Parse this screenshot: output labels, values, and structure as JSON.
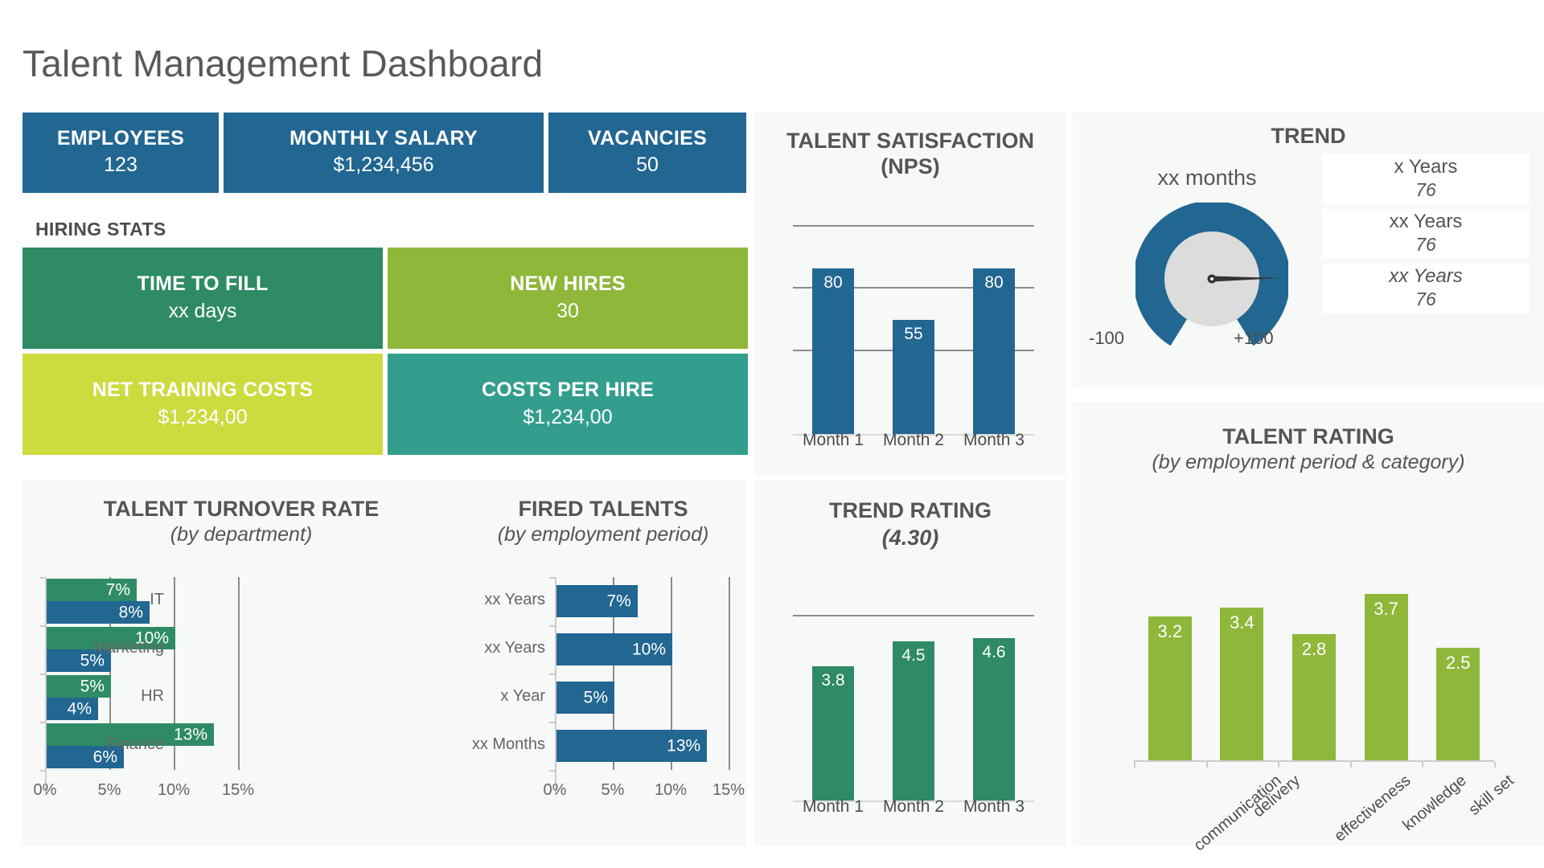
{
  "title": "Talent Management Dashboard",
  "colors": {
    "blue": "#226692",
    "dark_green": "#2e8b66",
    "green": "#8fb73a",
    "yellow_green": "#ccdb3e",
    "teal": "#339e8d",
    "panel_bg": "#f7f8f8",
    "text": "#555555"
  },
  "kpis": [
    {
      "label": "EMPLOYEES",
      "value": "123"
    },
    {
      "label": "MONTHLY SALARY",
      "value": "$1,234,456"
    },
    {
      "label": "VACANCIES",
      "value": "50"
    }
  ],
  "hiring": {
    "section_label": "HIRING STATS",
    "tiles": [
      {
        "label": "TIME TO FILL",
        "value": "xx days"
      },
      {
        "label": "NEW HIRES",
        "value": "30"
      },
      {
        "label": "NET TRAINING COSTS",
        "value": "$1,234,00"
      },
      {
        "label": "COSTS PER HIRE",
        "value": "$1,234,00"
      }
    ]
  },
  "trend": {
    "title": "TREND",
    "months_label": "xx months",
    "gauge_min_label": "-100",
    "gauge_max_label": "+100",
    "cards": [
      {
        "label": "x Years",
        "value": "76"
      },
      {
        "label": "xx Years",
        "value": "76"
      },
      {
        "label": "xx Years",
        "value": "76"
      }
    ]
  },
  "chart_data": [
    {
      "type": "bar",
      "id": "nps",
      "title": "TALENT SATISFACTION",
      "subtitle": "(NPS)",
      "categories": [
        "Month 1",
        "Month 2",
        "Month 3"
      ],
      "values": [
        80,
        55,
        80
      ],
      "value_labels": [
        "80",
        "55",
        "80"
      ],
      "series": [
        {
          "name": "NPS",
          "values": [
            80,
            55,
            80
          ]
        }
      ],
      "ylim": [
        0,
        100
      ],
      "gridlines": [
        40,
        70,
        100
      ],
      "grid": true,
      "legend": "none",
      "xlabel": "",
      "ylabel": "",
      "color": "#226692"
    },
    {
      "type": "bar",
      "id": "trend-rating",
      "title": "TREND RATING",
      "subtitle": "(4.30)",
      "categories": [
        "Month 1",
        "Month 2",
        "Month 3"
      ],
      "values": [
        3.8,
        4.5,
        4.6
      ],
      "value_labels": [
        "3.8",
        "4.5",
        "4.6"
      ],
      "series": [
        {
          "name": "Rating",
          "values": [
            3.8,
            4.5,
            4.6
          ]
        }
      ],
      "ylim": [
        0,
        5.5
      ],
      "gridlines": [
        5.2
      ],
      "grid": true,
      "legend": "none",
      "xlabel": "",
      "ylabel": "",
      "color": "#2e8b66"
    },
    {
      "type": "bar",
      "id": "talent-turnover",
      "title": "TALENT TURNOVER RATE",
      "subtitle": "(by department)",
      "orientation": "horizontal",
      "categories": [
        "IT",
        "Marketing",
        "HR",
        "Finance"
      ],
      "series": [
        {
          "name": "green",
          "values": [
            7,
            10,
            5,
            13
          ],
          "color": "#2e8b66"
        },
        {
          "name": "blue",
          "values": [
            8,
            5,
            4,
            6
          ],
          "color": "#226692"
        }
      ],
      "value_labels": [
        [
          "7%",
          "10%",
          "5%",
          "13%"
        ],
        [
          "8%",
          "5%",
          "4%",
          "6%"
        ]
      ],
      "xticks": [
        "0%",
        "5%",
        "10%",
        "15%"
      ],
      "xlim": [
        0,
        15
      ],
      "grid": true,
      "legend": "none",
      "xlabel": "",
      "ylabel": ""
    },
    {
      "type": "bar",
      "id": "fired-talents",
      "title": "FIRED TALENTS",
      "subtitle": "(by employment period)",
      "orientation": "horizontal",
      "categories": [
        "xx Years",
        "xx Years",
        "x Year",
        "xx Months"
      ],
      "values": [
        7,
        10,
        5,
        13
      ],
      "value_labels": [
        "7%",
        "10%",
        "5%",
        "13%"
      ],
      "series": [
        {
          "name": "Fired",
          "values": [
            7,
            10,
            5,
            13
          ]
        }
      ],
      "xticks": [
        "0%",
        "5%",
        "10%",
        "15%"
      ],
      "xlim": [
        0,
        15
      ],
      "grid": true,
      "legend": "none",
      "xlabel": "",
      "ylabel": "",
      "color": "#226692"
    },
    {
      "type": "bar",
      "id": "talent-rating",
      "title": "TALENT RATING",
      "subtitle": "(by employment period & category)",
      "categories": [
        "communication",
        "delivery",
        "effectiveness",
        "knowledge",
        "skill set"
      ],
      "values": [
        3.2,
        3.4,
        2.8,
        3.7,
        2.5
      ],
      "value_labels": [
        "3.2",
        "3.4",
        "2.8",
        "3.7",
        "2.5"
      ],
      "series": [
        {
          "name": "Rating",
          "values": [
            3.2,
            3.4,
            2.8,
            3.7,
            2.5
          ]
        }
      ],
      "ylim": [
        0,
        5
      ],
      "grid": false,
      "legend": "none",
      "xlabel": "",
      "ylabel": "",
      "color": "#8fb73a"
    }
  ]
}
